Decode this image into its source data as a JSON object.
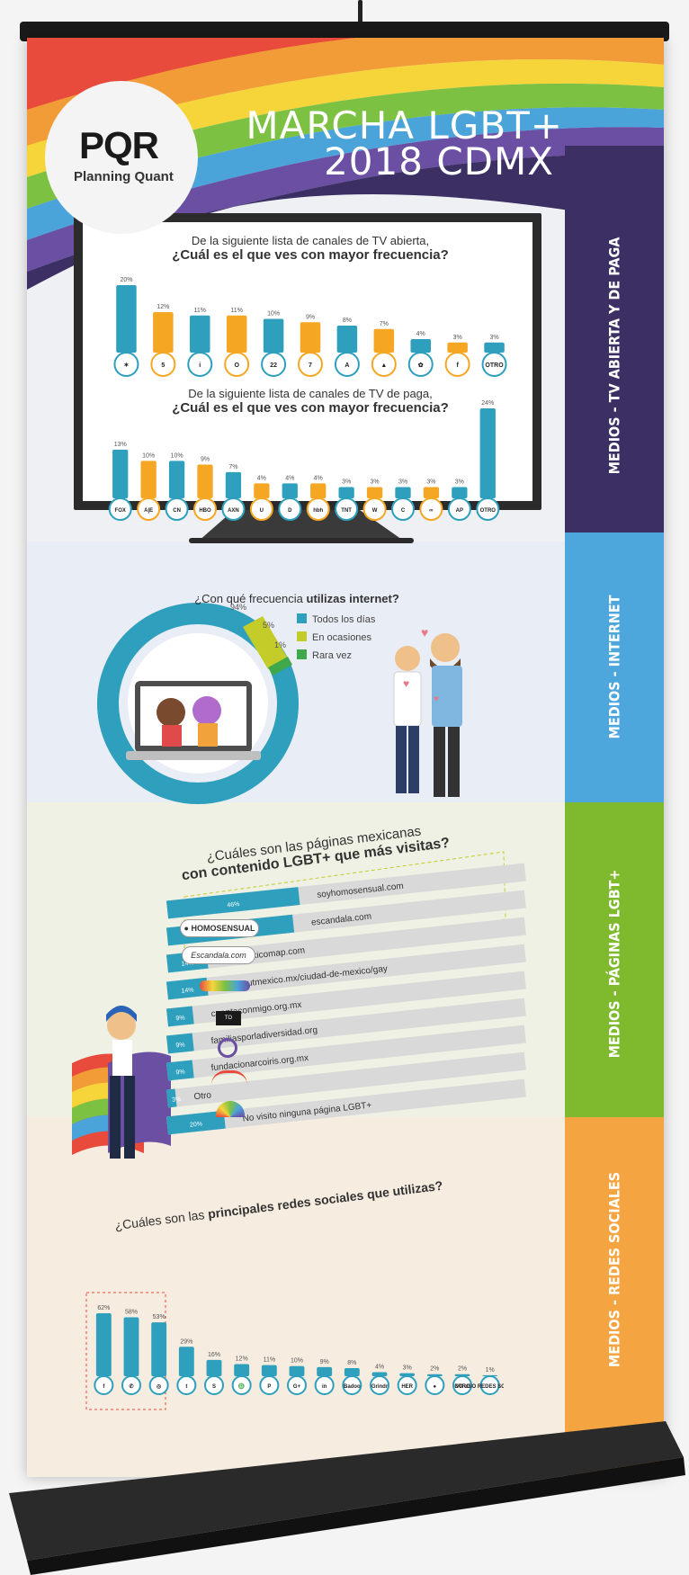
{
  "header": {
    "logo": "PQR",
    "logo_sub": "Planning Quant",
    "title_line1": "MARCHA LGBT+",
    "title_line2": "2018 CDMX"
  },
  "side_labels": {
    "tv": "MEDIOS - TV ABIERTA Y DE PAGA",
    "internet": "MEDIOS - INTERNET",
    "pages": "MEDIOS - PÁGINAS LGBT+",
    "social": "MEDIOS - REDES SOCIALES"
  },
  "colors": {
    "teal": "#2e9fbd",
    "orange": "#f5a623",
    "olive": "#c4cc2a",
    "green": "#3fa84a",
    "navy": "#3b2f63",
    "blue": "#4da6dc",
    "lime": "#7fba2e",
    "amber": "#f4a541"
  },
  "chart_data": [
    {
      "type": "bar",
      "title": "De la siguiente lista de canales de TV abierta, ¿Cuál es el que ves con mayor frecuencia?",
      "q_line1": "De la siguiente lista de canales de TV abierta,",
      "q_line2": "¿Cuál es el que ves con mayor frecuencia?",
      "categories": [
        "Canal de las Estrellas",
        "Canal 5",
        "Imagen",
        "Once",
        "Canal 22",
        "Azteca 7",
        "Azteca 13",
        "Canal 28",
        "Canal 2",
        "Foro TV",
        "OTRO"
      ],
      "badges": [
        "✶",
        "5",
        "i",
        "O",
        "22",
        "7",
        "A",
        "▲",
        "✿",
        "f",
        "OTRO"
      ],
      "values": [
        20,
        12,
        11,
        11,
        10,
        9,
        8,
        7,
        4,
        3,
        3
      ],
      "value_labels": [
        "20%",
        "12%",
        "11%",
        "11%",
        "10%",
        "9%",
        "8%",
        "7%",
        "4%",
        "3%",
        "3%"
      ]
    },
    {
      "type": "bar",
      "title": "De la siguiente lista de canales de TV de paga, ¿Cuál es el que ves con mayor frecuencia?",
      "q_line1": "De la siguiente lista de canales de TV de paga,",
      "q_line2": "¿Cuál es el que ves con mayor frecuencia?",
      "categories": [
        "FOX",
        "A&E",
        "CN",
        "HBO",
        "AXN",
        "Universal",
        "Discovery",
        "hbh",
        "TNT",
        "Warner",
        "Cinemax",
        "Discovery Kids",
        "Animal Planet",
        "OTRO"
      ],
      "badges": [
        "FOX",
        "A|E",
        "CN",
        "HBO",
        "AXN",
        "U",
        "D",
        "hbh",
        "TNT",
        "W",
        "C",
        "∞",
        "AP",
        "OTRO"
      ],
      "values": [
        13,
        10,
        10,
        9,
        7,
        4,
        4,
        4,
        3,
        3,
        3,
        3,
        3,
        24
      ],
      "value_labels": [
        "13%",
        "10%",
        "10%",
        "9%",
        "7%",
        "4%",
        "4%",
        "4%",
        "3%",
        "3%",
        "3%",
        "3%",
        "3%",
        "24%"
      ]
    },
    {
      "type": "pie",
      "title": "¿Con qué frecuencia utilizas internet?",
      "q_plain": "¿Con qué frecuencia ",
      "q_bold": "utilizas internet?",
      "categories": [
        "Todos los días",
        "En ocasiones",
        "Rara vez"
      ],
      "values": [
        94,
        5,
        1
      ],
      "value_labels": [
        "94%",
        "5%",
        "1%"
      ]
    },
    {
      "type": "bar",
      "title": "¿Cuáles son las páginas mexicanas con contenido LGBT+ que más visitas?",
      "q_line1": "¿Cuáles son las páginas mexicanas",
      "q_line2": "con contenido LGBT+ que más visitas?",
      "categories": [
        "soyhomosensual.com",
        "escandala.com",
        "gaymexicomap.com",
        "timeoutmexico.mx/ciudad-de-mexico/gay",
        "cuentaconmigo.org.mx",
        "familiasporladiversidad.org",
        "fundacionarcoiris.org.mx",
        "Otro",
        "No visito ninguna página LGBT+"
      ],
      "values": [
        46,
        44,
        14,
        14,
        9,
        9,
        9,
        3,
        20
      ],
      "value_labels": [
        "46%",
        "44%",
        "14%",
        "14%",
        "9%",
        "9%",
        "9%",
        "3%",
        "20%"
      ]
    },
    {
      "type": "bar",
      "title": "¿Cuáles son las principales redes sociales que utilizas?",
      "q_plain": "¿Cuáles son las ",
      "q_bold": "principales redes sociales que utilizas?",
      "categories": [
        "Facebook",
        "WhatsApp",
        "Instagram",
        "Twitter",
        "Snapchat",
        "Snapchat Ghost",
        "Pinterest",
        "Google+",
        "LinkedIn",
        "Badoo",
        "Grindr",
        "HER",
        "Tinder",
        "OTRO",
        "NO USO REDES SOCIALES"
      ],
      "badges": [
        "f",
        "✆",
        "◎",
        "t",
        "S",
        "♎",
        "P",
        "G+",
        "in",
        "Badoo",
        "Grindr",
        "HER",
        "●",
        "OTRO",
        "NO USO REDES SOCIALES"
      ],
      "values": [
        62,
        58,
        53,
        29,
        16,
        12,
        11,
        10,
        9,
        8,
        4,
        3,
        2,
        2,
        1
      ],
      "value_labels": [
        "62%",
        "58%",
        "53%",
        "29%",
        "16%",
        "12%",
        "11%",
        "10%",
        "9%",
        "8%",
        "4%",
        "3%",
        "2%",
        "2%",
        "1%"
      ]
    }
  ]
}
